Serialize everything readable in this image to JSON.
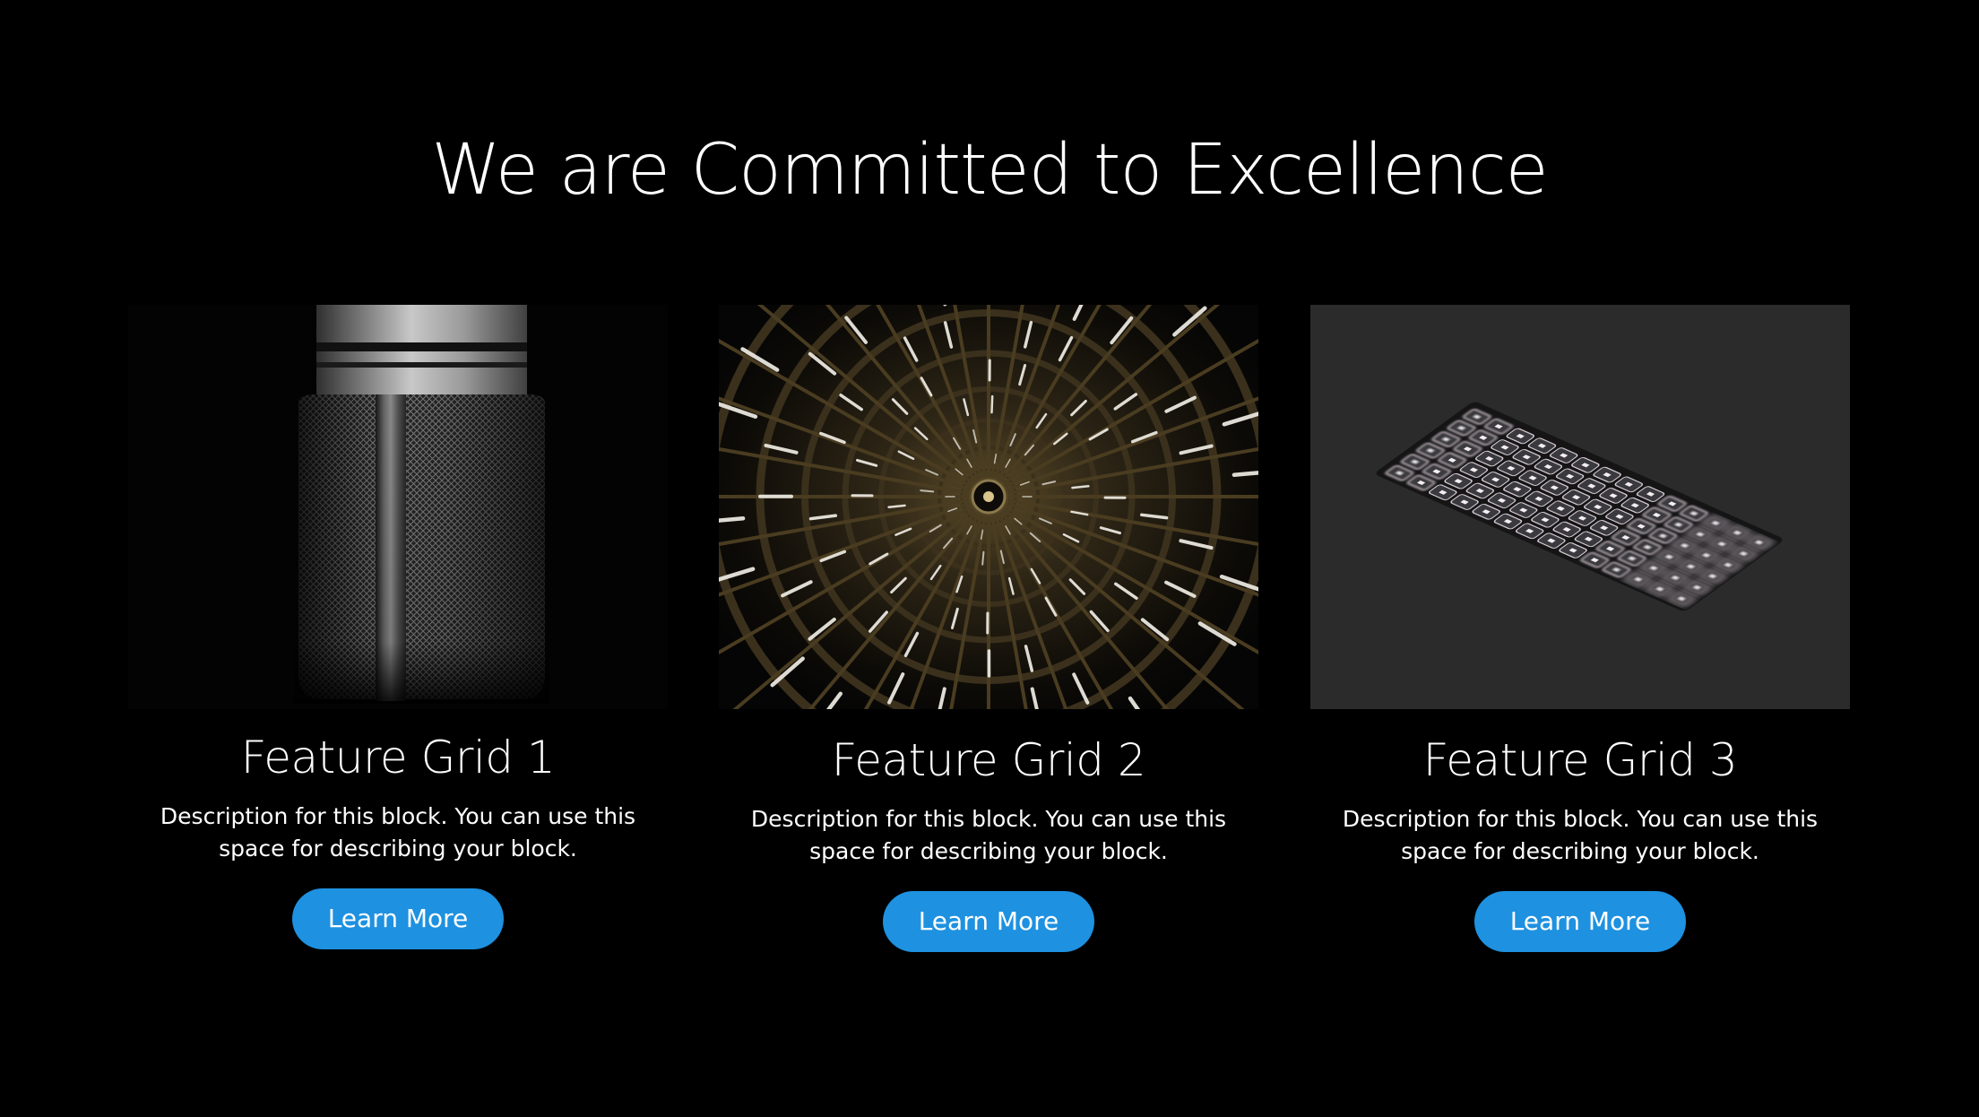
{
  "heading": "We are Committed to Excellence",
  "cards": [
    {
      "title": "Feature Grid 1",
      "description": "Description for this block. You can use this space for describing your block.",
      "button_label": "Learn More",
      "image_subject": "microphone"
    },
    {
      "title": "Feature Grid 2",
      "description": "Description for this block. You can use this space for describing your block.",
      "button_label": "Learn More",
      "image_subject": "radial-light-ceiling"
    },
    {
      "title": "Feature Grid 3",
      "description": "Description for this block. You can use this space for describing your block.",
      "button_label": "Learn More",
      "image_subject": "backlit-keyboard"
    }
  ],
  "colors": {
    "background": "#000000",
    "button": "#1e91e0",
    "text": "#ffffff"
  }
}
